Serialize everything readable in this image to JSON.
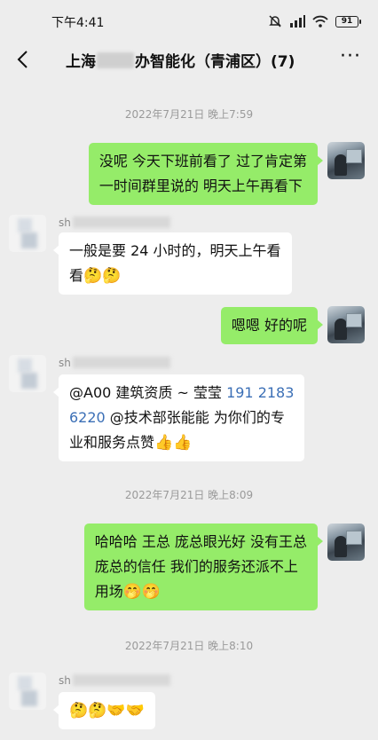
{
  "status": {
    "time": "下午4:41",
    "battery": "91"
  },
  "header": {
    "title_prefix": "上海",
    "title_suffix": "办智能化（青浦区）(7)",
    "more": "···"
  },
  "messages": [
    {
      "type": "timestamp",
      "text": "2022年7月21日 晚上7:59"
    },
    {
      "type": "mine",
      "lines": [
        "没呢 今天下班前看了 过了肯定第",
        "一时间群里说的  明天上午再看下"
      ]
    },
    {
      "type": "theirs",
      "sender": "sh",
      "lines": [
        "一般是要 24 小时的，明天上午看",
        "看"
      ],
      "emoji": "🤔🤔"
    },
    {
      "type": "mine",
      "lines": [
        "嗯嗯  好的呢"
      ]
    },
    {
      "type": "theirs",
      "sender": "sh",
      "line1": "@A00 建筑资质 ~ 莹莹 ",
      "phone1": "191 2183",
      "phone2": "6220",
      "line2_rest": " @技术部张能能  为你们的专",
      "line3": "业和服务点赞",
      "emoji": "👍👍"
    },
    {
      "type": "timestamp",
      "text": "2022年7月21日 晚上8:09"
    },
    {
      "type": "mine",
      "lines": [
        "哈哈哈  王总  庞总眼光好 没有王总",
        "庞总的信任  我们的服务还派不上",
        "用场"
      ],
      "emoji": "🤭🤭"
    },
    {
      "type": "timestamp",
      "text": "2022年7月21日 晚上8:10"
    },
    {
      "type": "theirs",
      "sender": "sh",
      "emoji": "🤔🤔🤝🤝"
    }
  ]
}
